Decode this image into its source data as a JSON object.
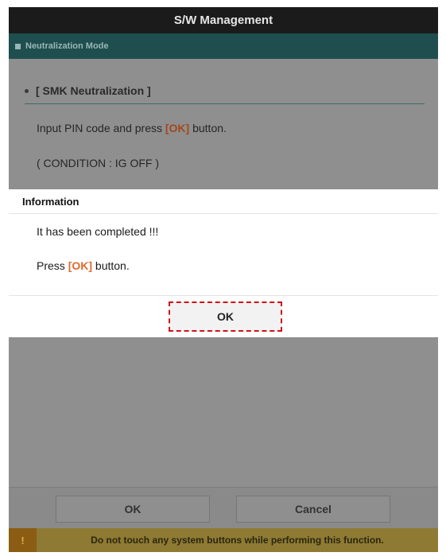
{
  "window": {
    "title": "S/W Management"
  },
  "mode": {
    "label": "Neutralization Mode"
  },
  "section": {
    "title": "[ SMK Neutralization ]",
    "instruction_prefix": "Input PIN code and press ",
    "instruction_ok": "[OK]",
    "instruction_suffix": " button.",
    "condition": "( CONDITION : IG OFF )"
  },
  "dialog": {
    "title": "Information",
    "message": "It has been completed !!!",
    "prompt_prefix": "Press ",
    "prompt_ok": "[OK]",
    "prompt_suffix": " button.",
    "ok_label": "OK"
  },
  "footer": {
    "ok_label": "OK",
    "cancel_label": "Cancel",
    "warning_icon": "!",
    "warning_text": "Do not touch any system buttons while performing this function."
  },
  "colors": {
    "titlebar": "#1b1b1b",
    "subheader": "#1f4e4f",
    "highlight_ok": "#e06a2c",
    "callout_border": "#d0121b",
    "warning_bar": "#8e7a32"
  }
}
